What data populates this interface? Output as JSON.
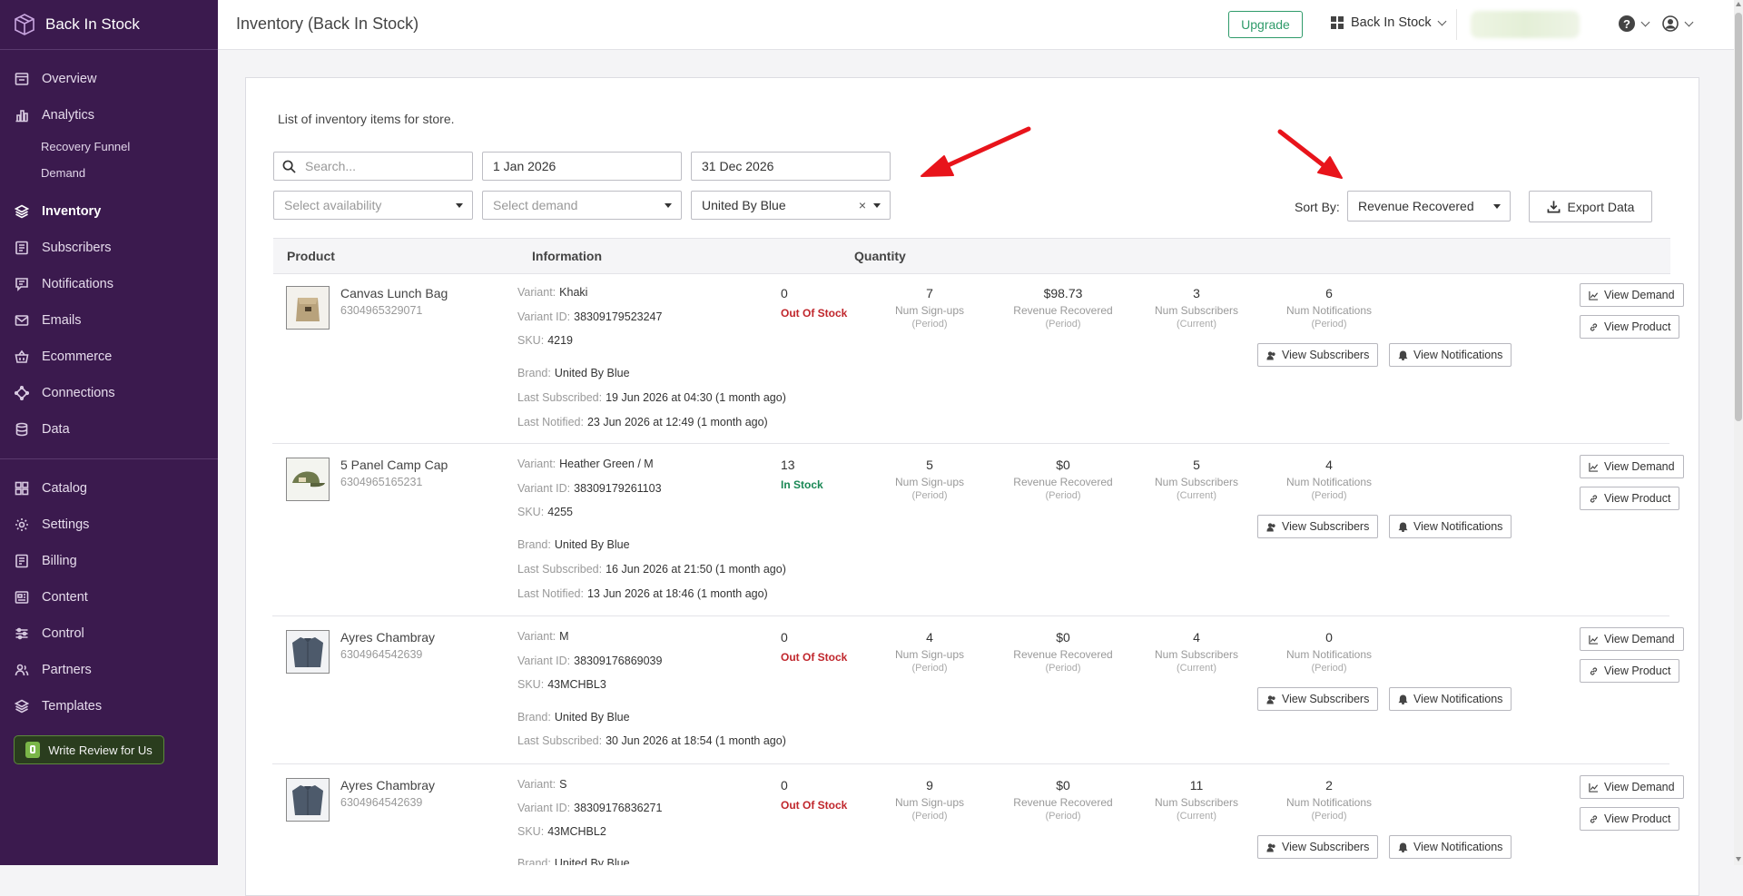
{
  "sidebar": {
    "brand": "Back In Stock",
    "items": [
      {
        "label": "Overview",
        "icon": "overview-icon"
      },
      {
        "label": "Analytics",
        "icon": "analytics-icon"
      },
      {
        "label": "Recovery Funnel"
      },
      {
        "label": "Demand"
      },
      {
        "label": "Inventory",
        "icon": "inventory-icon"
      },
      {
        "label": "Subscribers",
        "icon": "subscribers-icon"
      },
      {
        "label": "Notifications",
        "icon": "notifications-icon"
      },
      {
        "label": "Emails",
        "icon": "emails-icon"
      },
      {
        "label": "Ecommerce",
        "icon": "ecommerce-icon"
      },
      {
        "label": "Connections",
        "icon": "connections-icon"
      },
      {
        "label": "Data",
        "icon": "data-icon"
      },
      {
        "label": "Catalog",
        "icon": "catalog-icon"
      },
      {
        "label": "Settings",
        "icon": "settings-icon"
      },
      {
        "label": "Billing",
        "icon": "billing-icon"
      },
      {
        "label": "Content",
        "icon": "content-icon"
      },
      {
        "label": "Control",
        "icon": "control-icon"
      },
      {
        "label": "Partners",
        "icon": "partners-icon"
      },
      {
        "label": "Templates",
        "icon": "templates-icon"
      }
    ],
    "review_button": "Write Review for Us"
  },
  "header": {
    "title": "Inventory (Back In Stock)",
    "upgrade": "Upgrade",
    "store": "Back In Stock"
  },
  "main": {
    "description": "List of inventory items for store.",
    "filters": {
      "search_placeholder": "Search...",
      "start_date": "1 Jan 2026",
      "end_date": "31 Dec 2026",
      "availability_placeholder": "Select availability",
      "demand_placeholder": "Select demand",
      "brand": "United By Blue",
      "clear": "×"
    },
    "sort_label": "Sort By:",
    "sort_value": "Revenue Recovered",
    "export": "Export Data",
    "columns": {
      "product": "Product",
      "information": "Information",
      "quantity": "Quantity"
    },
    "labels": {
      "variant": "Variant:",
      "variant_id": "Variant ID:",
      "sku": "SKU:",
      "brand": "Brand:",
      "last_subscribed": "Last Subscribed:",
      "last_notified": "Last Notified:",
      "signups": "Num Sign-ups",
      "revenue": "Revenue Recovered",
      "subscribers": "Num Subscribers",
      "notifications": "Num Notifications",
      "period": "(Period)",
      "current": "(Current)",
      "view_subscribers": "View Subscribers",
      "view_notifications": "View Notifications",
      "view_demand": "View Demand",
      "view_product": "View Product"
    },
    "rows": [
      {
        "name": "Canvas Lunch Bag",
        "id": "6304965329071",
        "variant": "Khaki",
        "variant_id": "38309179523247",
        "sku": "4219",
        "brand": "United By Blue",
        "last_subscribed": "19 Jun 2026 at 04:30 (1 month ago)",
        "last_notified": "23 Jun 2026 at 12:49 (1 month ago)",
        "quantity": "0",
        "status": "Out Of Stock",
        "signups": "7",
        "revenue": "$98.73",
        "subscribers": "3",
        "notifications": "6"
      },
      {
        "name": "5 Panel Camp Cap",
        "id": "6304965165231",
        "variant": "Heather Green / M",
        "variant_id": "38309179261103",
        "sku": "4255",
        "brand": "United By Blue",
        "last_subscribed": "16 Jun 2026 at 21:50 (1 month ago)",
        "last_notified": "13 Jun 2026 at 18:46 (1 month ago)",
        "quantity": "13",
        "status": "In Stock",
        "signups": "5",
        "revenue": "$0",
        "subscribers": "5",
        "notifications": "4"
      },
      {
        "name": "Ayres Chambray",
        "id": "6304964542639",
        "variant": "M",
        "variant_id": "38309176869039",
        "sku": "43MCHBL3",
        "brand": "United By Blue",
        "last_subscribed": "30 Jun 2026 at 18:54 (1 month ago)",
        "quantity": "0",
        "status": "Out Of Stock",
        "signups": "4",
        "revenue": "$0",
        "subscribers": "4",
        "notifications": "0"
      },
      {
        "name": "Ayres Chambray",
        "id": "6304964542639",
        "variant": "S",
        "variant_id": "38309176836271",
        "sku": "43MCHBL2",
        "brand": "United By Blue",
        "quantity": "0",
        "status": "Out Of Stock",
        "signups": "9",
        "revenue": "$0",
        "subscribers": "11",
        "notifications": "2"
      }
    ]
  },
  "colors": {
    "sidebar": "#3b1a4e",
    "accent": "#2f9b6a",
    "out_of_stock": "#c0262c",
    "in_stock": "#198754",
    "arrow": "#e8141b"
  }
}
